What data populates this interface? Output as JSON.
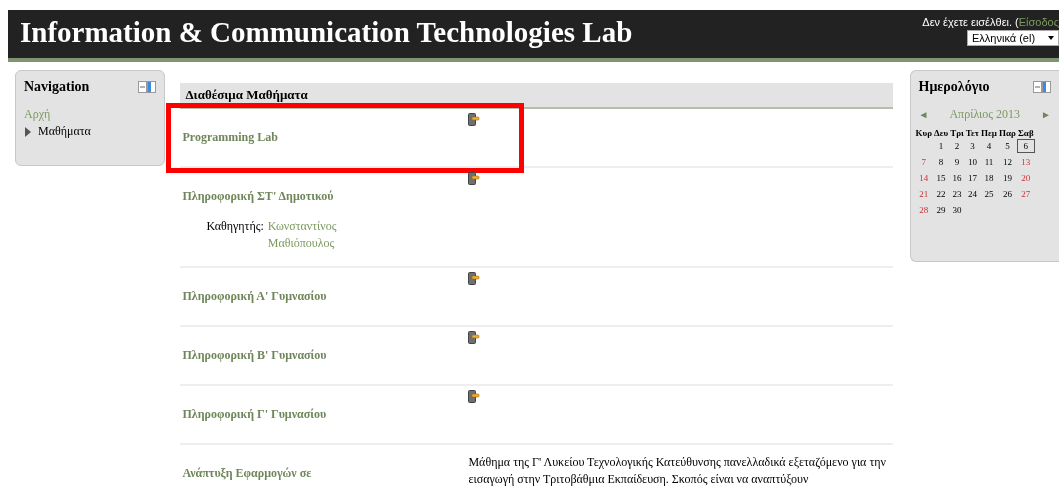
{
  "header": {
    "title": "Information & Communication Technologies Lab",
    "login_text": "Δεν έχετε εισέλθει. (",
    "login_link": "Είσοδος",
    "language": "Ελληνικά (el)"
  },
  "navigation": {
    "title": "Navigation",
    "items": [
      {
        "label": "Αρχή",
        "kind": "link"
      },
      {
        "label": "Μαθήματα",
        "kind": "branch",
        "expanded": false
      }
    ]
  },
  "courses": {
    "title": "Διαθέσιμα Μαθήματα",
    "items": [
      {
        "name": "Programming Lab",
        "enrol_icon": true,
        "highlighted": true
      },
      {
        "name": "Πληροφορική ΣΤ' Δημοτικού",
        "enrol_icon": true,
        "highlighted": false,
        "teacher_label": "Καθηγητής:",
        "teacher": "Κωνσταντίνος Μαθιόπουλος"
      },
      {
        "name": "Πληροφορική Α' Γυμνασίου",
        "enrol_icon": true,
        "highlighted": false
      },
      {
        "name": "Πληροφορική Β' Γυμνασίου",
        "enrol_icon": true,
        "highlighted": false
      },
      {
        "name": "Πληροφορική Γ' Γυμνασίου",
        "enrol_icon": true,
        "highlighted": false
      },
      {
        "name": "Ανάπτυξη Εφαρμογών σε",
        "enrol_icon": false,
        "highlighted": false,
        "description": "Μάθημα της Γ' Λυκείου Τεχνολογικής Κατεύθυνσης πανελλαδικά εξεταζόμενο για την εισαγωγή στην Τριτοβάθμια Εκπαίδευση. Σκοπός είναι να αναπτύξουν"
      }
    ]
  },
  "calendar": {
    "title": "Ημερολόγιο",
    "month": "Απρίλιος 2013",
    "prev": "◄",
    "next": "►",
    "weekdays": [
      "Κυρ",
      "Δευ",
      "Τρι",
      "Τετ",
      "Πεμ",
      "Παρ",
      "Σαβ"
    ],
    "weeks": [
      [
        {
          "day": "1",
          "weekend": false,
          "today": false
        },
        {
          "day": "2",
          "weekend": false,
          "today": false
        },
        {
          "day": "3",
          "weekend": false,
          "today": false
        },
        {
          "day": "4",
          "weekend": false,
          "today": false
        },
        {
          "day": "5",
          "weekend": false,
          "today": false
        },
        {
          "day": "6",
          "weekend": false,
          "today": true
        }
      ],
      [
        {
          "day": "7",
          "weekend": true,
          "today": false
        },
        {
          "day": "8",
          "weekend": false,
          "today": false
        },
        {
          "day": "9",
          "weekend": false,
          "today": false
        },
        {
          "day": "10",
          "weekend": false,
          "today": false
        },
        {
          "day": "11",
          "weekend": false,
          "today": false
        },
        {
          "day": "12",
          "weekend": false,
          "today": false
        },
        {
          "day": "13",
          "weekend": true,
          "today": false
        }
      ],
      [
        {
          "day": "14",
          "weekend": true,
          "today": false
        },
        {
          "day": "15",
          "weekend": false,
          "today": false
        },
        {
          "day": "16",
          "weekend": false,
          "today": false
        },
        {
          "day": "17",
          "weekend": false,
          "today": false
        },
        {
          "day": "18",
          "weekend": false,
          "today": false
        },
        {
          "day": "19",
          "weekend": false,
          "today": false
        },
        {
          "day": "20",
          "weekend": true,
          "today": false
        }
      ],
      [
        {
          "day": "21",
          "weekend": true,
          "today": false
        },
        {
          "day": "22",
          "weekend": false,
          "today": false
        },
        {
          "day": "23",
          "weekend": false,
          "today": false
        },
        {
          "day": "24",
          "weekend": false,
          "today": false
        },
        {
          "day": "25",
          "weekend": false,
          "today": false
        },
        {
          "day": "26",
          "weekend": false,
          "today": false
        },
        {
          "day": "27",
          "weekend": true,
          "today": false
        }
      ],
      [
        {
          "day": "28",
          "weekend": true,
          "today": false
        },
        {
          "day": "29",
          "weekend": false,
          "today": false
        },
        {
          "day": "30",
          "weekend": false,
          "today": false
        }
      ]
    ]
  }
}
